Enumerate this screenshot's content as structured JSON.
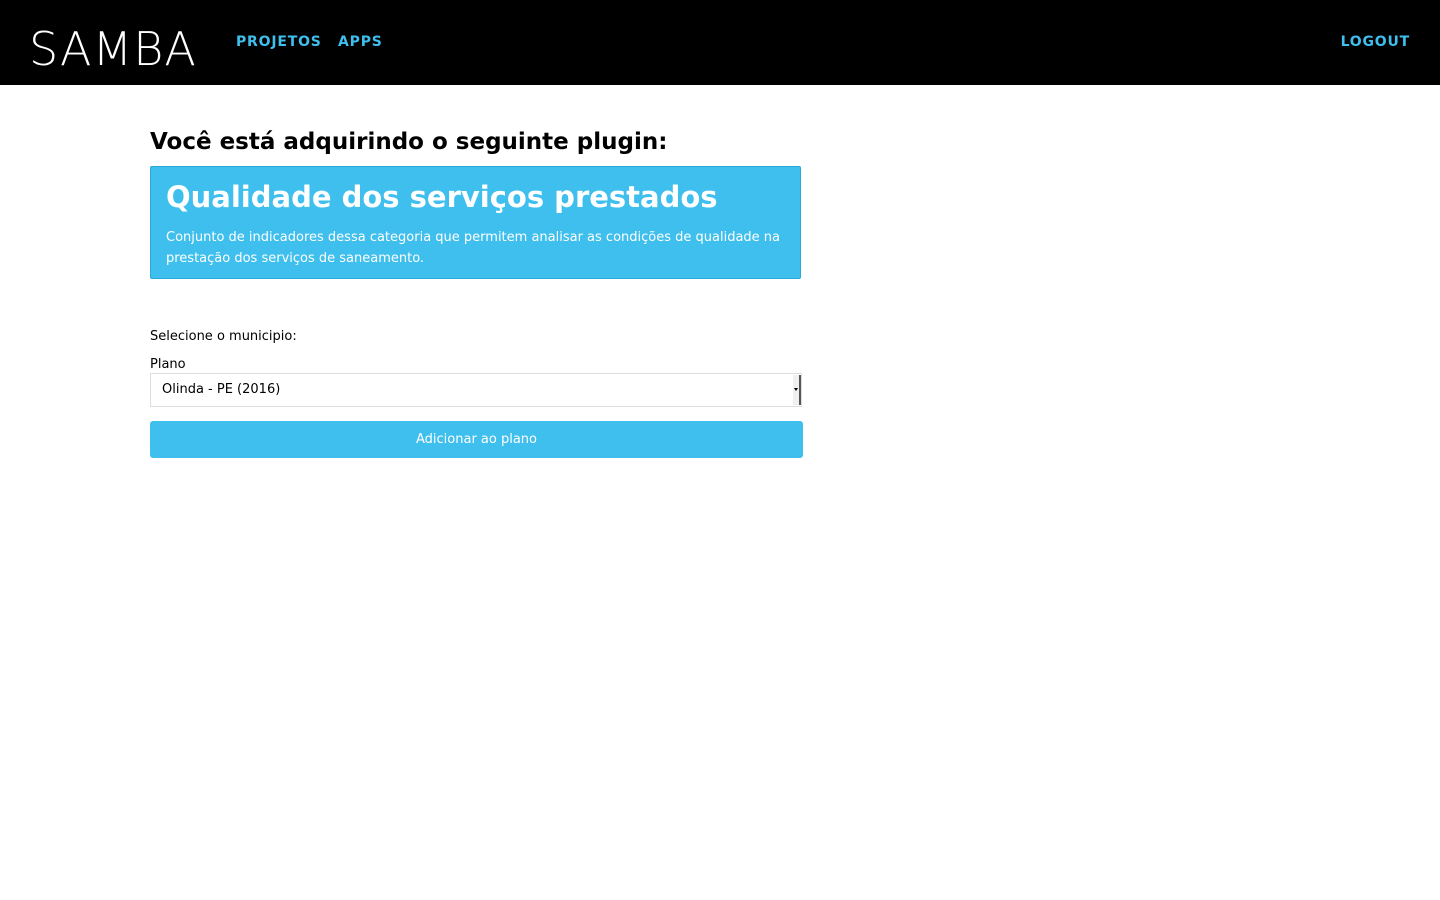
{
  "header": {
    "logo_text": "SAMBA",
    "nav": {
      "projetos": "PROJETOS",
      "apps": "APPS"
    },
    "logout": "LOGOUT"
  },
  "main": {
    "heading": "Você está adquirindo o seguinte plugin:",
    "plugin": {
      "title": "Qualidade dos serviços prestados",
      "description": "Conjunto de indicadores dessa categoria que permitem analisar as condições de qualidade na prestação dos serviços de saneamento."
    },
    "select_prompt": "Selecione o municipio:",
    "plano_label": "Plano",
    "plano_selected": "Olinda - PE (2016)",
    "add_button": "Adicionar ao plano"
  },
  "colors": {
    "navbar_bg": "#000000",
    "accent": "#3fbfee",
    "text_on_accent": "#ffffff"
  }
}
